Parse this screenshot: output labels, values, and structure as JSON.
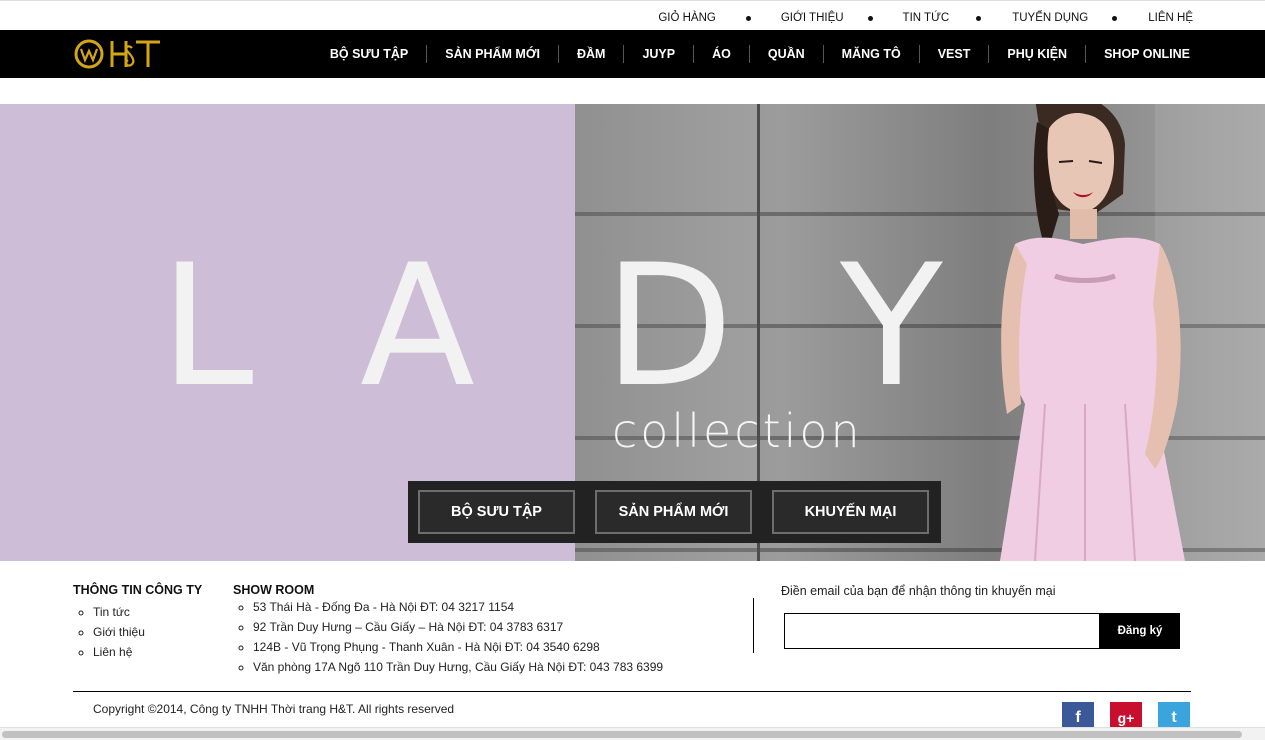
{
  "top_links": [
    "GIỎ HÀNG",
    "GIỚI THIỆU",
    "TIN TỨC",
    "TUYỂN DỤNG",
    "LIÊN HỆ"
  ],
  "logo_text": "H&T",
  "nav": [
    "BỘ SƯU TẬP",
    "SẢN PHẨM MỚI",
    "ĐẦM",
    "JUYP",
    "ÁO",
    "QUẦN",
    "MĂNG TÔ",
    "VEST",
    "PHỤ KIỆN",
    "SHOP ONLINE"
  ],
  "hero": {
    "letters": [
      "L",
      "A",
      "D",
      "Y"
    ],
    "subtitle": "collection",
    "buttons": [
      "BỘ SƯU TẬP",
      "SẢN PHẨM MỚI",
      "KHUYẾN MẠI"
    ]
  },
  "footer": {
    "company_title": "THÔNG TIN CÔNG TY",
    "company_links": [
      "Tin tức",
      "Giới thiệu",
      "Liên hệ"
    ],
    "showroom_title": "SHOW ROOM",
    "showrooms": [
      "53 Thái Hà - Đống Đa - Hà Nội ĐT: 04 3217 1154",
      "92 Trần Duy Hưng – Cầu Giấy – Hà Nội ĐT: 04 3783 6317",
      "124B - Vũ Trọng Phụng - Thanh Xuân - Hà Nội ĐT: 04 3540 6298",
      "Văn phòng 17A Ngõ 110 Trần Duy Hưng, Cầu Giấy Hà Nội ĐT: 043 783 6399"
    ],
    "email_label": "Điền email của bạn để nhận thông tin khuyến mại",
    "email_value": "",
    "subscribe_label": "Đăng ký",
    "copyright": "Copyright ©2014, Công ty TNHH Thời trang H&T. All rights reserved",
    "social": [
      {
        "name": "facebook-icon",
        "glyph": "f",
        "color": "#3b5998"
      },
      {
        "name": "google-plus-icon",
        "glyph": "g+",
        "color": "#c8102e"
      },
      {
        "name": "twitter-icon",
        "glyph": "t",
        "color": "#3aa5dd"
      }
    ]
  },
  "colors": {
    "brand_gold": "#d4a615",
    "nav_bg": "#000000",
    "hero_lilac": "#cdbdd6",
    "dress_pink": "#f0cde3"
  }
}
